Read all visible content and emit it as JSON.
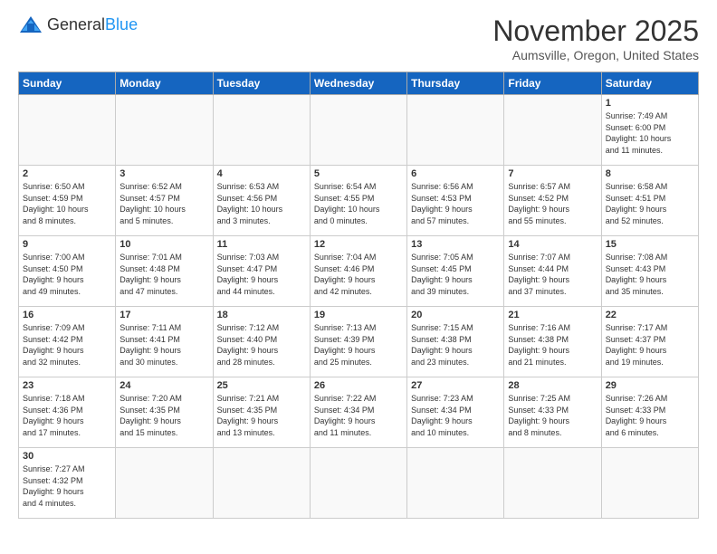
{
  "logo": {
    "general": "General",
    "blue": "Blue"
  },
  "title": "November 2025",
  "subtitle": "Aumsville, Oregon, United States",
  "days_of_week": [
    "Sunday",
    "Monday",
    "Tuesday",
    "Wednesday",
    "Thursday",
    "Friday",
    "Saturday"
  ],
  "weeks": [
    [
      {
        "day": "",
        "info": ""
      },
      {
        "day": "",
        "info": ""
      },
      {
        "day": "",
        "info": ""
      },
      {
        "day": "",
        "info": ""
      },
      {
        "day": "",
        "info": ""
      },
      {
        "day": "",
        "info": ""
      },
      {
        "day": "1",
        "info": "Sunrise: 7:49 AM\nSunset: 6:00 PM\nDaylight: 10 hours\nand 11 minutes."
      }
    ],
    [
      {
        "day": "2",
        "info": "Sunrise: 6:50 AM\nSunset: 4:59 PM\nDaylight: 10 hours\nand 8 minutes."
      },
      {
        "day": "3",
        "info": "Sunrise: 6:52 AM\nSunset: 4:57 PM\nDaylight: 10 hours\nand 5 minutes."
      },
      {
        "day": "4",
        "info": "Sunrise: 6:53 AM\nSunset: 4:56 PM\nDaylight: 10 hours\nand 3 minutes."
      },
      {
        "day": "5",
        "info": "Sunrise: 6:54 AM\nSunset: 4:55 PM\nDaylight: 10 hours\nand 0 minutes."
      },
      {
        "day": "6",
        "info": "Sunrise: 6:56 AM\nSunset: 4:53 PM\nDaylight: 9 hours\nand 57 minutes."
      },
      {
        "day": "7",
        "info": "Sunrise: 6:57 AM\nSunset: 4:52 PM\nDaylight: 9 hours\nand 55 minutes."
      },
      {
        "day": "8",
        "info": "Sunrise: 6:58 AM\nSunset: 4:51 PM\nDaylight: 9 hours\nand 52 minutes."
      }
    ],
    [
      {
        "day": "9",
        "info": "Sunrise: 7:00 AM\nSunset: 4:50 PM\nDaylight: 9 hours\nand 49 minutes."
      },
      {
        "day": "10",
        "info": "Sunrise: 7:01 AM\nSunset: 4:48 PM\nDaylight: 9 hours\nand 47 minutes."
      },
      {
        "day": "11",
        "info": "Sunrise: 7:03 AM\nSunset: 4:47 PM\nDaylight: 9 hours\nand 44 minutes."
      },
      {
        "day": "12",
        "info": "Sunrise: 7:04 AM\nSunset: 4:46 PM\nDaylight: 9 hours\nand 42 minutes."
      },
      {
        "day": "13",
        "info": "Sunrise: 7:05 AM\nSunset: 4:45 PM\nDaylight: 9 hours\nand 39 minutes."
      },
      {
        "day": "14",
        "info": "Sunrise: 7:07 AM\nSunset: 4:44 PM\nDaylight: 9 hours\nand 37 minutes."
      },
      {
        "day": "15",
        "info": "Sunrise: 7:08 AM\nSunset: 4:43 PM\nDaylight: 9 hours\nand 35 minutes."
      }
    ],
    [
      {
        "day": "16",
        "info": "Sunrise: 7:09 AM\nSunset: 4:42 PM\nDaylight: 9 hours\nand 32 minutes."
      },
      {
        "day": "17",
        "info": "Sunrise: 7:11 AM\nSunset: 4:41 PM\nDaylight: 9 hours\nand 30 minutes."
      },
      {
        "day": "18",
        "info": "Sunrise: 7:12 AM\nSunset: 4:40 PM\nDaylight: 9 hours\nand 28 minutes."
      },
      {
        "day": "19",
        "info": "Sunrise: 7:13 AM\nSunset: 4:39 PM\nDaylight: 9 hours\nand 25 minutes."
      },
      {
        "day": "20",
        "info": "Sunrise: 7:15 AM\nSunset: 4:38 PM\nDaylight: 9 hours\nand 23 minutes."
      },
      {
        "day": "21",
        "info": "Sunrise: 7:16 AM\nSunset: 4:38 PM\nDaylight: 9 hours\nand 21 minutes."
      },
      {
        "day": "22",
        "info": "Sunrise: 7:17 AM\nSunset: 4:37 PM\nDaylight: 9 hours\nand 19 minutes."
      }
    ],
    [
      {
        "day": "23",
        "info": "Sunrise: 7:18 AM\nSunset: 4:36 PM\nDaylight: 9 hours\nand 17 minutes."
      },
      {
        "day": "24",
        "info": "Sunrise: 7:20 AM\nSunset: 4:35 PM\nDaylight: 9 hours\nand 15 minutes."
      },
      {
        "day": "25",
        "info": "Sunrise: 7:21 AM\nSunset: 4:35 PM\nDaylight: 9 hours\nand 13 minutes."
      },
      {
        "day": "26",
        "info": "Sunrise: 7:22 AM\nSunset: 4:34 PM\nDaylight: 9 hours\nand 11 minutes."
      },
      {
        "day": "27",
        "info": "Sunrise: 7:23 AM\nSunset: 4:34 PM\nDaylight: 9 hours\nand 10 minutes."
      },
      {
        "day": "28",
        "info": "Sunrise: 7:25 AM\nSunset: 4:33 PM\nDaylight: 9 hours\nand 8 minutes."
      },
      {
        "day": "29",
        "info": "Sunrise: 7:26 AM\nSunset: 4:33 PM\nDaylight: 9 hours\nand 6 minutes."
      }
    ],
    [
      {
        "day": "30",
        "info": "Sunrise: 7:27 AM\nSunset: 4:32 PM\nDaylight: 9 hours\nand 4 minutes."
      },
      {
        "day": "",
        "info": ""
      },
      {
        "day": "",
        "info": ""
      },
      {
        "day": "",
        "info": ""
      },
      {
        "day": "",
        "info": ""
      },
      {
        "day": "",
        "info": ""
      },
      {
        "day": "",
        "info": ""
      }
    ]
  ]
}
